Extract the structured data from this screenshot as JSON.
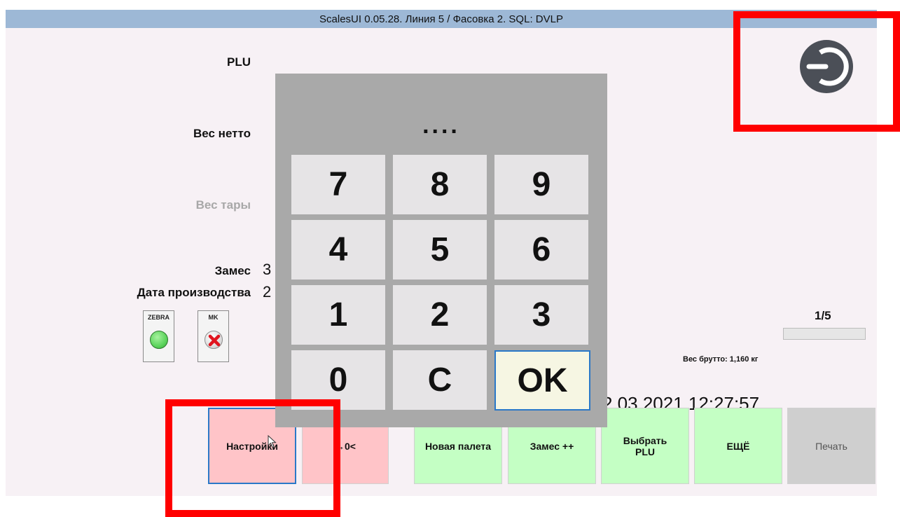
{
  "window": {
    "title": "ScalesUI 0.05.28.  Линия 5 / Фасовка 2. SQL: DVLP"
  },
  "fields": {
    "plu_label": "PLU",
    "net_weight_label": "Вес нетто",
    "tare_weight_label": "Вес тары",
    "batch_label": "Замес",
    "batch_value": "3",
    "production_date_label": "Дата производства",
    "production_date_value": "2"
  },
  "indicators": {
    "zebra": {
      "label": "ZEBRA",
      "status": "ok",
      "color": "#5cd45c"
    },
    "mk": {
      "label": "MK",
      "status": "error",
      "color": "#e0141e"
    }
  },
  "status": {
    "counter": "1/5",
    "progress": 0,
    "gross_weight": "Вес брутто: 1,160 кг",
    "datetime": "2.03.2021 12:27:57"
  },
  "keypad": {
    "display": "....",
    "keys": [
      "7",
      "8",
      "9",
      "4",
      "5",
      "6",
      "1",
      "2",
      "3",
      "0",
      "C",
      "OK"
    ]
  },
  "buttons": {
    "settings": "Настройки",
    "zero": "→0<",
    "new_pallet": "Новая палета",
    "batch_inc": "Замес ++",
    "choose_plu": "Выбрать PLU",
    "more": "ЕЩЁ",
    "print": "Печать"
  },
  "icons": {
    "exit": "power-icon",
    "mouse_cursor": "cursor-icon"
  },
  "colors": {
    "title_bar": "#9db8d6",
    "pink_button": "#ffc4c8",
    "green_button": "#c4ffc4",
    "gray_button": "#cfcfcf",
    "keypad_bg": "#a9a9a9",
    "highlight": "#ff0000"
  }
}
